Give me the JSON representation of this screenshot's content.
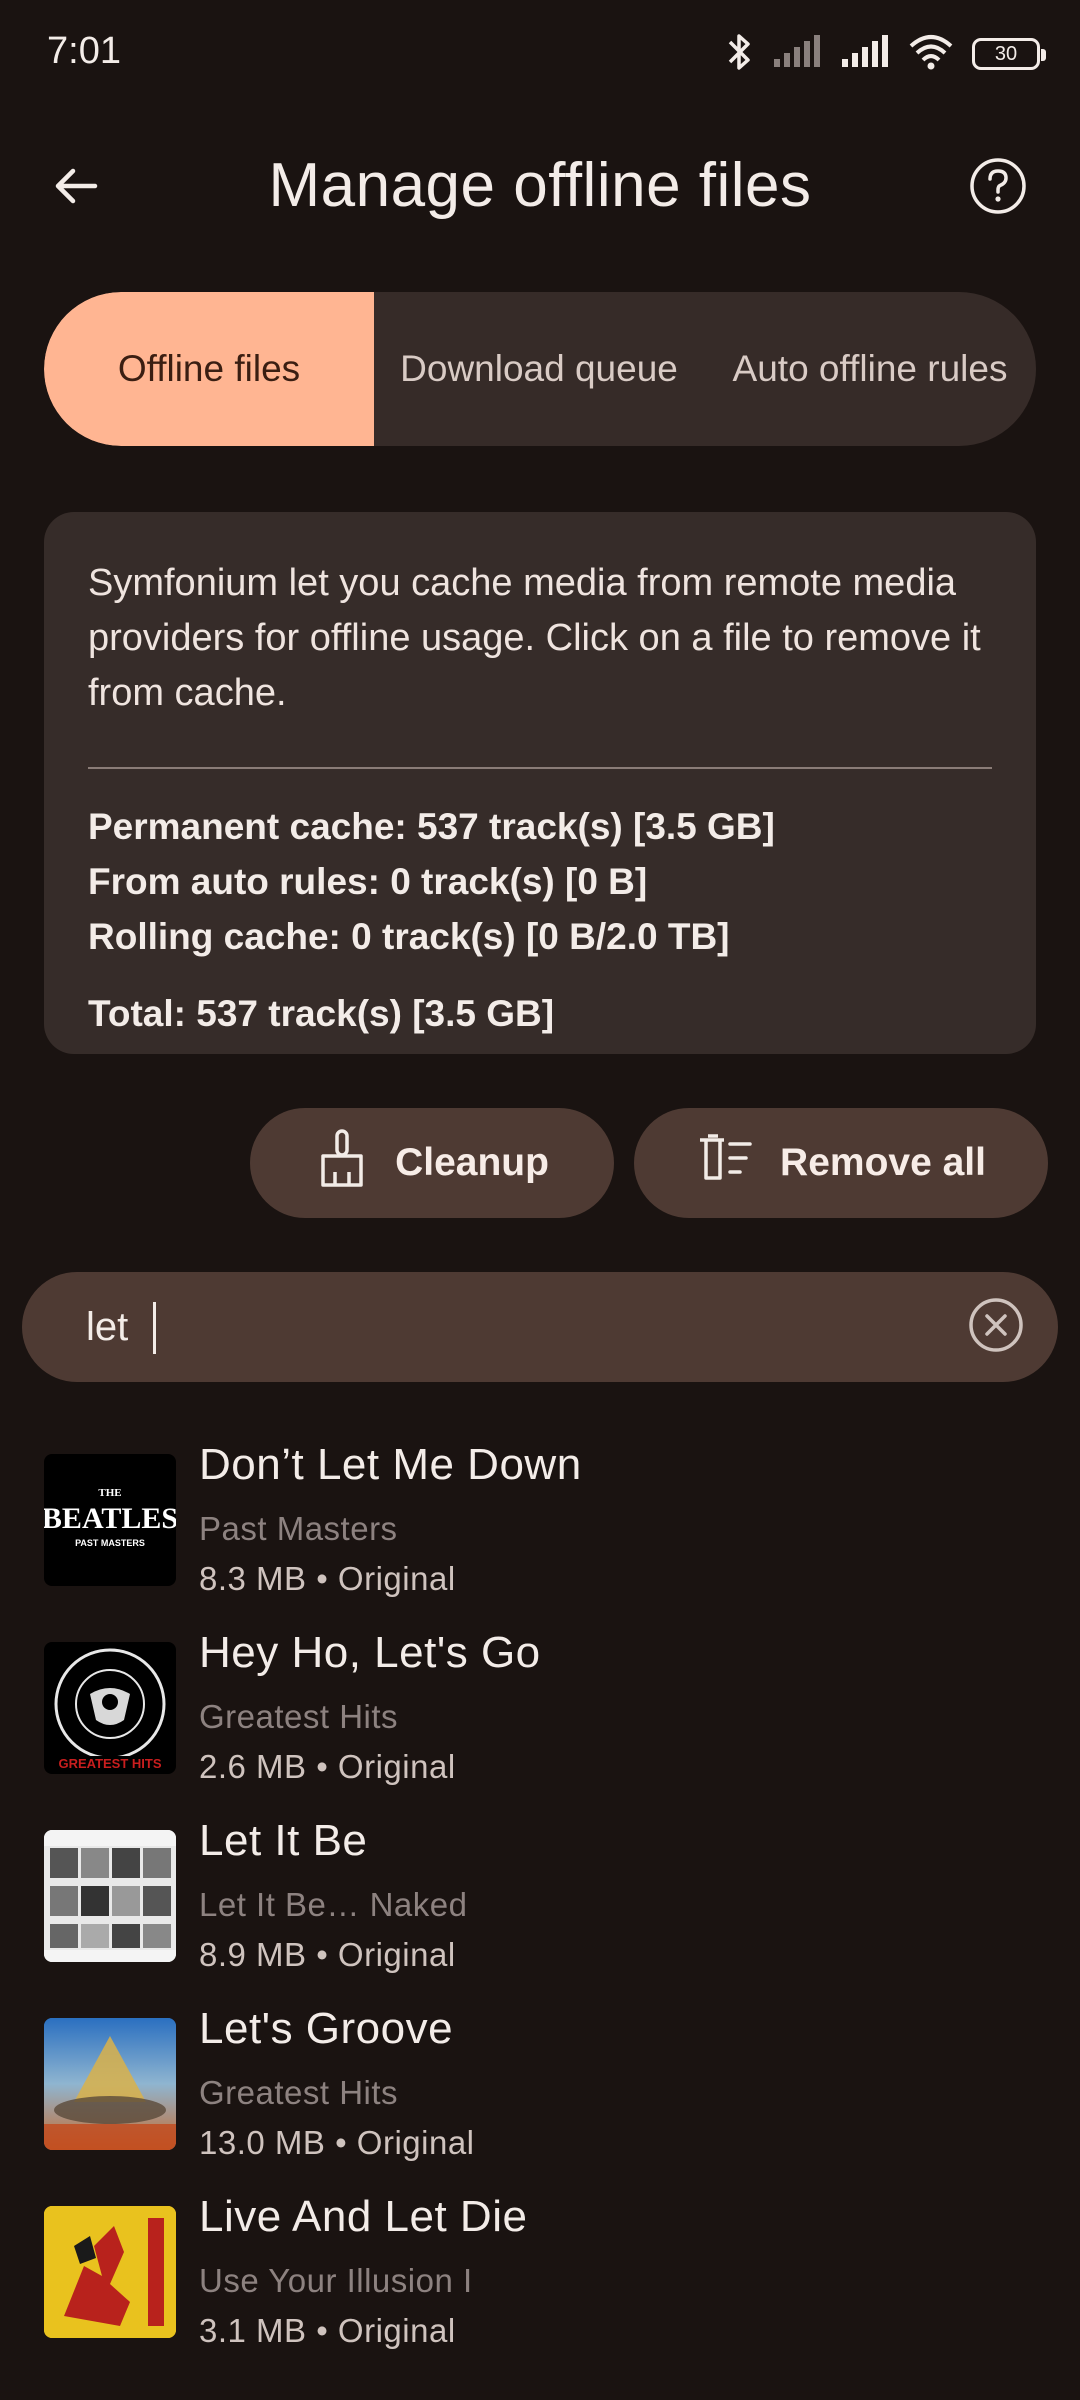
{
  "status_bar": {
    "time": "7:01",
    "battery": "30",
    "icons": [
      "bluetooth-icon",
      "signal-icon",
      "signal-icon",
      "wifi-icon",
      "battery-icon"
    ]
  },
  "header": {
    "title": "Manage offline files",
    "back_icon": "arrow-left-icon",
    "help_icon": "help-circle-icon"
  },
  "tabs": [
    {
      "label": "Offline files",
      "selected": true
    },
    {
      "label": "Download queue",
      "selected": false
    },
    {
      "label": "Auto offline rules",
      "selected": false
    }
  ],
  "info": {
    "description": "Symfonium let you cache media from remote media providers for offline usage. Click on a file to remove it from cache.",
    "permanent": "Permanent cache: 537 track(s) [3.5 GB]",
    "auto_rules": "From auto rules: 0 track(s) [0 B]",
    "rolling": "Rolling cache: 0 track(s) [0 B/2.0 TB]",
    "total": "Total: 537 track(s) [3.5 GB]"
  },
  "actions": {
    "cleanup_label": "Cleanup",
    "remove_all_label": "Remove all"
  },
  "search": {
    "value": "let"
  },
  "tracks": [
    {
      "title": "Don’t Let Me Down",
      "album": "Past Masters",
      "meta": "8.3 MB • Original"
    },
    {
      "title": "Hey Ho, Let's Go",
      "album": "Greatest Hits",
      "meta": "2.6 MB • Original"
    },
    {
      "title": "Let It Be",
      "album": "Let It Be… Naked",
      "meta": "8.9 MB • Original"
    },
    {
      "title": "Let's Groove",
      "album": "Greatest Hits",
      "meta": "13.0 MB • Original"
    },
    {
      "title": "Live And Let Die",
      "album": "Use Your Illusion I",
      "meta": "3.1 MB • Original"
    }
  ],
  "colors": {
    "background": "#1a1311",
    "accent": "#ffb592",
    "card": "#362c29",
    "button": "#4e3a33"
  }
}
